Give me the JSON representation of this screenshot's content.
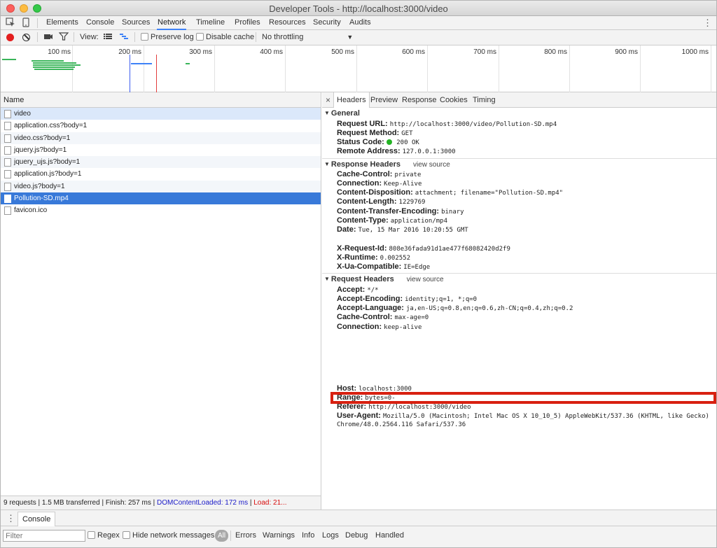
{
  "window": {
    "title": "Developer Tools - http://localhost:3000/video"
  },
  "tabs": [
    "Elements",
    "Console",
    "Sources",
    "Network",
    "Timeline",
    "Profiles",
    "Resources",
    "Security",
    "Audits"
  ],
  "active_tab": "Network",
  "toolbar": {
    "view_label": "View:",
    "preserve_log": "Preserve log",
    "disable_cache": "Disable cache",
    "throttling": "No throttling"
  },
  "overview": {
    "ticks": [
      "100 ms",
      "200 ms",
      "300 ms",
      "400 ms",
      "500 ms",
      "600 ms",
      "700 ms",
      "800 ms",
      "900 ms",
      "1000 ms"
    ]
  },
  "requests": {
    "header": "Name",
    "items": [
      "video",
      "application.css?body=1",
      "video.css?body=1",
      "jquery.js?body=1",
      "jquery_ujs.js?body=1",
      "application.js?body=1",
      "video.js?body=1",
      "Pollution-SD.mp4",
      "favicon.ico"
    ],
    "selected": "Pollution-SD.mp4"
  },
  "summary": {
    "requests": "9 requests",
    "transferred": "1.5 MB transferred",
    "finish": "Finish: 257 ms",
    "dom": "DOMContentLoaded: 172 ms",
    "load": "Load: 21..."
  },
  "detail": {
    "close": "×",
    "tabs": [
      "Headers",
      "Preview",
      "Response",
      "Cookies",
      "Timing"
    ],
    "general_title": "General",
    "general": [
      {
        "k": "Request URL:",
        "v": "http://localhost:3000/video/Pollution-SD.mp4"
      },
      {
        "k": "Request Method:",
        "v": "GET"
      },
      {
        "k": "Status Code:",
        "v": "200 OK"
      },
      {
        "k": "Remote Address:",
        "v": "127.0.0.1:3000"
      }
    ],
    "response_title": "Response Headers",
    "view_source": "view source",
    "response": [
      {
        "k": "Cache-Control:",
        "v": "private"
      },
      {
        "k": "Connection:",
        "v": "Keep-Alive"
      },
      {
        "k": "Content-Disposition:",
        "v": "attachment; filename=\"Pollution-SD.mp4\""
      },
      {
        "k": "Content-Length:",
        "v": "1229769"
      },
      {
        "k": "Content-Transfer-Encoding:",
        "v": "binary"
      },
      {
        "k": "Content-Type:",
        "v": "application/mp4"
      },
      {
        "k": "Date:",
        "v": "Tue, 15 Mar 2016 10:20:55 GMT"
      },
      {
        "k": "X-Request-Id:",
        "v": "808e36fada91d1ae477f68082420d2f9"
      },
      {
        "k": "X-Runtime:",
        "v": "0.002552"
      },
      {
        "k": "X-Ua-Compatible:",
        "v": "IE=Edge"
      }
    ],
    "request_title": "Request Headers",
    "request": [
      {
        "k": "Accept:",
        "v": "*/*"
      },
      {
        "k": "Accept-Encoding:",
        "v": "identity;q=1, *;q=0"
      },
      {
        "k": "Accept-Language:",
        "v": "ja,en-US;q=0.8,en;q=0.6,zh-CN;q=0.4,zh;q=0.2"
      },
      {
        "k": "Cache-Control:",
        "v": "max-age=0"
      },
      {
        "k": "Connection:",
        "v": "keep-alive"
      },
      {
        "k": "Host:",
        "v": "localhost:3000"
      },
      {
        "k": "Range:",
        "v": "bytes=0-"
      },
      {
        "k": "Referer:",
        "v": "http://localhost:3000/video"
      },
      {
        "k": "User-Agent:",
        "v": "Mozilla/5.0 (Macintosh; Intel Mac OS X 10_10_5) AppleWebKit/537.36 (KHTML, like Gecko)"
      }
    ],
    "user_agent_cont": "Chrome/48.0.2564.116 Safari/537.36"
  },
  "drawer": {
    "tab": "Console",
    "filter_placeholder": "Filter",
    "regex": "Regex",
    "hide_network": "Hide network messages",
    "levels": [
      "All",
      "Errors",
      "Warnings",
      "Info",
      "Logs",
      "Debug",
      "Handled"
    ]
  },
  "colors": {
    "accent": "#3e82f7",
    "selection": "#3879d9",
    "record": "#e31e1e",
    "status_ok": "#24b324",
    "highlight_box": "#d82010"
  }
}
